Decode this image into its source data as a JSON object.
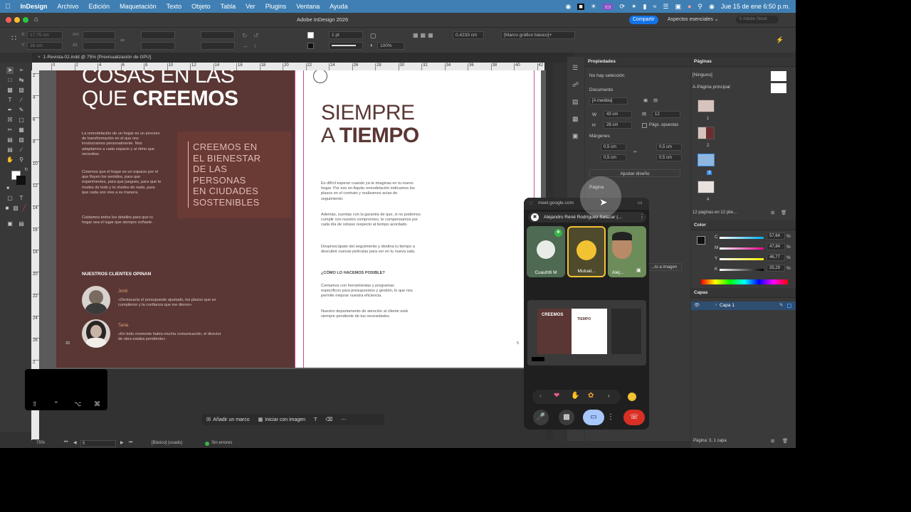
{
  "menubar": {
    "apple": "",
    "items": [
      "InDesign",
      "Archivo",
      "Edición",
      "Maquetación",
      "Texto",
      "Objeto",
      "Tabla",
      "Ver",
      "Plugins",
      "Ventana",
      "Ayuda"
    ],
    "datetime": "Jue 15 de ene  6:50 p.m."
  },
  "titlebar": {
    "title": "Adobe InDesign 2026",
    "share_label": "Compartir",
    "workspace_label": "Aspectos esenciales",
    "search_placeholder": "Adobe Stock"
  },
  "control": {
    "x": "17,75 cm",
    "y": "26 cm",
    "w_label": "An:",
    "h_label": "Al:",
    "stroke_weight": "1 pt",
    "percent": "100%",
    "dim": "0,4233 cm",
    "frame_style": "[Marco gráfico básico]+"
  },
  "doc_tab": "1-Revista-02.indd @ 75% [Previsualización de GPU]",
  "ruler_h": [
    "0",
    "2",
    "4",
    "6",
    "8",
    "10",
    "12",
    "14",
    "16",
    "18",
    "20",
    "22",
    "24",
    "26",
    "28",
    "30",
    "32",
    "34",
    "36",
    "38",
    "40",
    "42"
  ],
  "ruler_v": [
    "2",
    "4",
    "6",
    "8",
    "10",
    "12",
    "14",
    "16",
    "18",
    "20",
    "22",
    "24",
    "26",
    "2"
  ],
  "left_page": {
    "title_light": "COSAS EN LAS",
    "title_light2": "QUE ",
    "title_bold": "CREEMOS",
    "para1": "La remodelación de un hogar es un proceso de transformación en el que nos involucramos personalmente. Nos adaptamos a cada espacio y al ritmo que necesitas.",
    "para2": "Creemos que el hogar es un espacio por el que fluyen los sentidos, para que experimentes, para que juegues, para que te mudes de todo y te olvides de nada, para que cada uno viva a su manera.",
    "para3": "Cuidamos todos los detalles para que tu hogar sea el lugar que siempre soñaste.",
    "quote": "CREEMOS EN\nEL BIENESTAR\nDE LAS\nPERSONAS\nEN CIUDADES\nSOSTENIBLES",
    "clients_heading": "NUESTROS CLIENTES OPINAN",
    "client1_name": "Jordi",
    "client1_text": "«Destacaría el presupuesto ajustado, los plazos que se cumplieron y la confianza que me dieron»",
    "client2_name": "Tania",
    "client2_text": "«En todo momento había mucha comunicación, el director de obra estaba pendiente»",
    "page_number": "20"
  },
  "right_page": {
    "title_light": "SIEMPRE",
    "title_light2": "A ",
    "title_bold": "TIEMPO",
    "para1": "Es difícil esperar cuando ya te imaginas en tu nuevo hogar. Por eso en Aquitu remodelación indicamos los plazos en el contrato y realizamos actas de seguimiento.",
    "para2": "Además, cuentas con la garantía de que, si no podemos cumplir con nuestro compromiso, te compensamos por cada día de retraso respecto al tiempo acordado.",
    "para3": "Despreocúpate del seguimiento y destina tu tiempo a descubrir nuevas películas para ver en tu nueva sala.",
    "subheading": "¿CÓMO LO HACEMOS POSIBLE?",
    "para4": "Contamos con herramientas y programas específicos para presupuestos y gestión, lo que nos permite mejorar nuestra eficiencia.",
    "para5": "Nuestro departamento de atención al cliente está siempre pendiente de tus necesidades.",
    "page_number": "5"
  },
  "float_bar": {
    "add_frame": "Añadir un marco",
    "start_image": "Iniciar con imagen"
  },
  "bottom_bar": {
    "zoom": "75%",
    "page": "5",
    "style": "[Básico] (usado)",
    "errors": "Sin errores"
  },
  "properties": {
    "title": "Propiedades",
    "no_selection": "No hay selección",
    "document_label": "Documento",
    "preset": "[A medida]",
    "w": "43 cm",
    "h": "28 cm",
    "pages": "12",
    "facing_label": "Págs. opuestas",
    "margins_label": "Márgenes",
    "m1": "0,5 cm",
    "m2": "0,5 cm",
    "m3": "0,5 cm",
    "m4": "0,5 cm",
    "adjust_label": "Ajustar diseño",
    "page_label": "Página",
    "adjust_image": "...to a imagen"
  },
  "pages_panel": {
    "title": "Páginas",
    "none": "[Ninguno]",
    "master": "A-Página principal",
    "nums": [
      "1",
      "2",
      "3",
      "4"
    ],
    "footer": "12 páginas en 12 plie..."
  },
  "color_panel": {
    "title": "Color",
    "c": "57,64",
    "m": "47,84",
    "y": "46,77",
    "k": "35,29",
    "labels": [
      "C",
      "M",
      "Y",
      "K"
    ],
    "pct": "%"
  },
  "layers_panel": {
    "title": "Capas",
    "layer1": "Capa 1",
    "footer": "Página: 3, 1 capa"
  },
  "meet": {
    "url": "meet.google.com",
    "presenter": "Alejandro René Rodríguez Salazar (...",
    "p1": "Cuauhtli M",
    "p2": "Mutual...",
    "p3": "Alej...",
    "thumb_title": "CREEMOS",
    "thumb_title2": "TIEMPO"
  },
  "colors": {
    "menubar": "#3f7fb3",
    "page_brown": "#5a3734",
    "accent_red": "#d93025",
    "share_blue": "#1473e6"
  }
}
